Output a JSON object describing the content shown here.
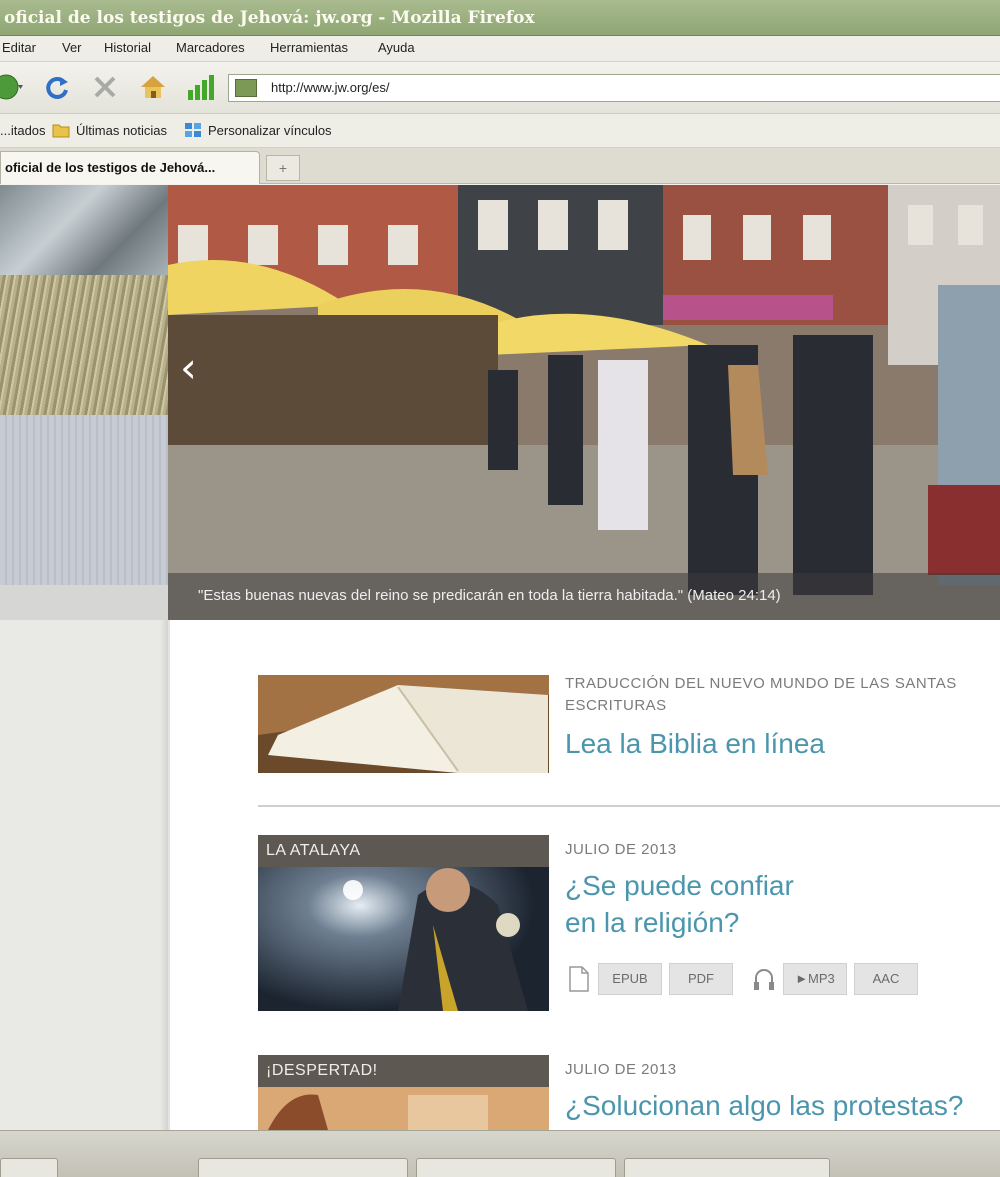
{
  "window": {
    "title": "oficial de los testigos de Jehová: jw.org - Mozilla Firefox"
  },
  "menu": {
    "items": [
      "Editar",
      "Ver",
      "Historial",
      "Marcadores",
      "Herramientas",
      "Ayuda"
    ]
  },
  "navbar": {
    "url": "http://www.jw.org/es/"
  },
  "bookmarks": {
    "items": [
      "...itados",
      "Últimas noticias",
      "Personalizar vínculos"
    ]
  },
  "tabs": {
    "active_label": "oficial de los testigos de Jehová...",
    "new_tab_label": "+"
  },
  "hero": {
    "caption": "\"Estas buenas nuevas del reino se predicarán en toda la tierra habitada.\" (Mateo 24:14)",
    "prev_arrow": "‹"
  },
  "articles": [
    {
      "kicker_lines": [
        "TRADUCCIÓN DEL NUEVO MUNDO DE LAS SANTAS",
        "ESCRITURAS"
      ],
      "headline_lines": [
        "Lea la Biblia en línea"
      ]
    },
    {
      "thumb_label": "LA ATALAYA",
      "kicker_lines": [
        "JULIO DE 2013"
      ],
      "headline_lines": [
        "¿Se puede confiar",
        "en la religión?"
      ],
      "downloads": [
        "EPUB",
        "PDF",
        "►MP3",
        "AAC"
      ]
    },
    {
      "thumb_label": "¡DESPERTAD!",
      "kicker_lines": [
        "JULIO DE 2013"
      ],
      "headline_lines": [
        "¿Solucionan algo las protestas?"
      ]
    }
  ],
  "colors": {
    "headline": "#4b96ad",
    "titlebar": "#8fa674"
  },
  "icons": [
    "back-icon",
    "reload-icon",
    "stop-icon",
    "home-icon",
    "signal-icon",
    "site-favicon",
    "folder-icon",
    "link-icon",
    "document-icon",
    "headphones-icon"
  ]
}
